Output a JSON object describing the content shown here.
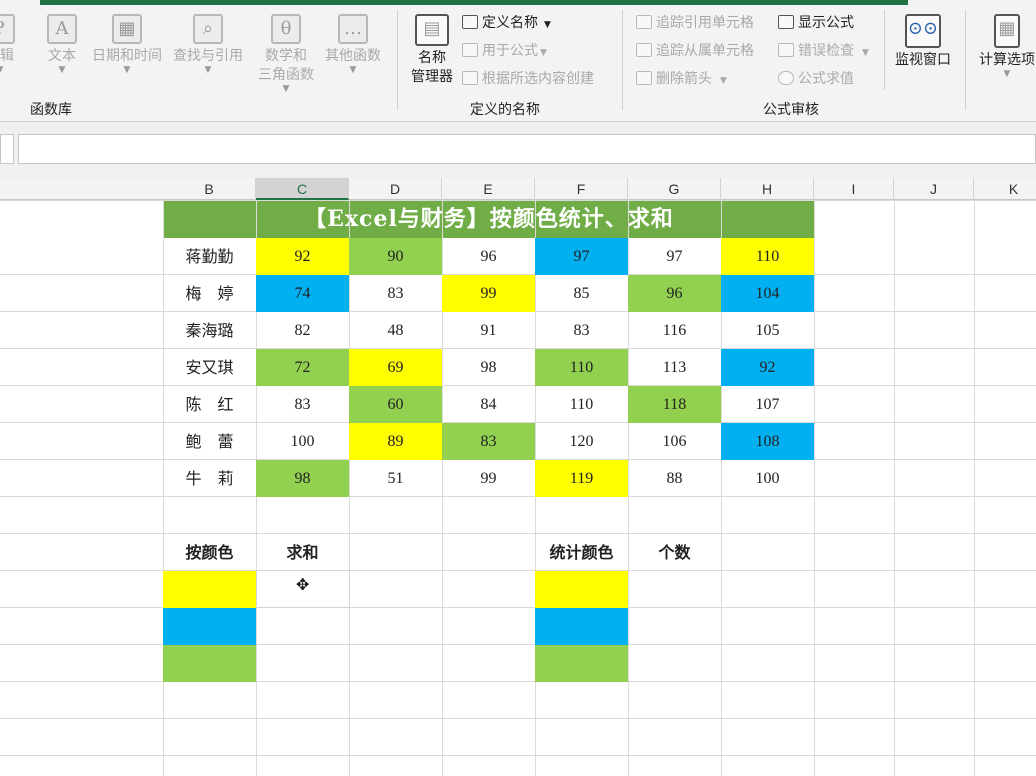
{
  "ribbon": {
    "function_library": {
      "label": "函数库",
      "buttons": [
        {
          "label": "逻辑",
          "icon": "question-icon",
          "glyph": "?"
        },
        {
          "label": "文本",
          "icon": "text-icon",
          "glyph": "A"
        },
        {
          "label": "日期和时间",
          "icon": "calendar-icon",
          "glyph": "▦"
        },
        {
          "label": "查找与引用",
          "icon": "lookup-icon",
          "glyph": "⌕"
        },
        {
          "label": "数学和\n三角函数",
          "icon": "math-icon",
          "glyph": "θ"
        },
        {
          "label": "其他函数",
          "icon": "more-functions-icon",
          "glyph": "…"
        }
      ]
    },
    "defined_names": {
      "label": "定义的名称",
      "name_manager": {
        "line1": "名称",
        "line2": "管理器"
      },
      "define_name": "定义名称",
      "use_in_formula": "用于公式",
      "create_from_selection": "根据所选内容创建"
    },
    "formula_auditing": {
      "label": "公式审核",
      "trace_precedents": "追踪引用单元格",
      "trace_dependents": "追踪从属单元格",
      "remove_arrows": "删除箭头",
      "show_formulas": "显示公式",
      "error_checking": "错误检查",
      "evaluate_formula": "公式求值",
      "watch_window": "监视窗口"
    },
    "calculation": {
      "options": "计算选项"
    }
  },
  "columns": [
    "B",
    "C",
    "D",
    "E",
    "F",
    "G",
    "H",
    "I",
    "J",
    "K"
  ],
  "selected_column": "C",
  "banner_title": "【Excel与财务】按颜色统计、求和",
  "colors": {
    "yellow": "#ffff00",
    "blue": "#00b0f0",
    "green": "#92d050",
    "banner_green": "#70ad47",
    "excel_green": "#217346"
  },
  "table": {
    "rows": [
      {
        "name": "蒋勤勤",
        "values": [
          "92",
          "90",
          "96",
          "97",
          "97",
          "110"
        ],
        "fills": [
          "yellow",
          "green",
          "",
          "blue",
          "",
          "yellow"
        ]
      },
      {
        "name": "梅　婷",
        "values": [
          "74",
          "83",
          "99",
          "85",
          "96",
          "104"
        ],
        "fills": [
          "blue",
          "",
          "yellow",
          "",
          "green",
          "blue"
        ]
      },
      {
        "name": "秦海璐",
        "values": [
          "82",
          "48",
          "91",
          "83",
          "116",
          "105"
        ],
        "fills": [
          "",
          "",
          "",
          "",
          "",
          ""
        ]
      },
      {
        "name": "安又琪",
        "values": [
          "72",
          "69",
          "98",
          "110",
          "113",
          "92"
        ],
        "fills": [
          "green",
          "yellow",
          "",
          "green",
          "",
          "blue"
        ]
      },
      {
        "name": "陈　红",
        "values": [
          "83",
          "60",
          "84",
          "110",
          "118",
          "107"
        ],
        "fills": [
          "",
          "green",
          "",
          "",
          "green",
          ""
        ]
      },
      {
        "name": "鲍　蕾",
        "values": [
          "100",
          "89",
          "83",
          "120",
          "106",
          "108"
        ],
        "fills": [
          "",
          "yellow",
          "green",
          "",
          "",
          "blue"
        ]
      },
      {
        "name": "牛　莉",
        "values": [
          "98",
          "51",
          "99",
          "119",
          "88",
          "100"
        ],
        "fills": [
          "green",
          "",
          "",
          "yellow",
          "",
          ""
        ]
      }
    ]
  },
  "summary": {
    "sum_header_color": "按颜色",
    "sum_header_value": "求和",
    "count_header_color": "统计颜色",
    "count_header_value": "个数",
    "swatches": [
      "yellow",
      "blue",
      "green"
    ]
  }
}
